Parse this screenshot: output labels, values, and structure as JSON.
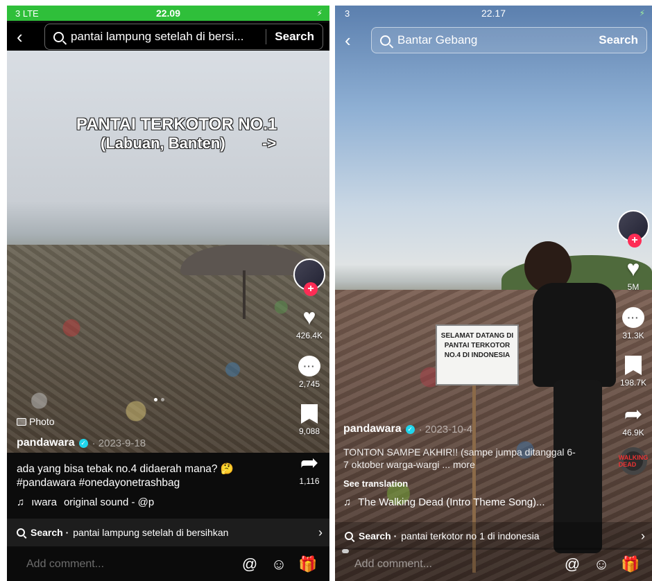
{
  "left": {
    "status": {
      "signal": "3 LTE",
      "time": "22.09",
      "battery": "⚡"
    },
    "search": {
      "query": "pantai lampung setelah di bersi...",
      "button": "Search"
    },
    "overlay": {
      "line1": "PANTAI TERKOTOR NO.1",
      "line2": "(Labuan, Banten)",
      "arrow": "->"
    },
    "photo_tag": "Photo",
    "rail": {
      "likes": "426.4K",
      "comments": "2,745",
      "saves": "9,088",
      "shares": "1,116"
    },
    "user": {
      "name": "pandawara",
      "date": "· 2023-9-18"
    },
    "caption": "ada yang bisa tebak no.4 didaerah mana? 🤔 #pandawara #onedayonetrashbag",
    "music": {
      "artist": "ıwara",
      "title": "original sound - @p"
    },
    "related": {
      "label": "Search ·",
      "query": "pantai lampung setelah di bersihkan"
    },
    "comment_placeholder": "Add comment..."
  },
  "right": {
    "status": {
      "signal": "3",
      "time": "22.17",
      "battery": "⚡"
    },
    "search": {
      "query": "Bantar Gebang",
      "button": "Search"
    },
    "sign": {
      "text": "SELAMAT DATANG DI PANTAI TERKOTOR NO.4 DI INDONESIA"
    },
    "rail": {
      "likes": "5M",
      "comments": "31.3K",
      "saves": "198.7K",
      "shares": "46.9K",
      "disc": "WALKING DEAD"
    },
    "user": {
      "name": "pandawara",
      "date": "· 2023-10-4"
    },
    "caption": "TONTON SAMPE AKHIR!! (sampe jumpa ditanggal 6-7 oktober warga-wargi ... more",
    "see_translation": "See translation",
    "music": {
      "title": "The Walking Dead (Intro Theme Song)..."
    },
    "related": {
      "label": "Search ·",
      "query": "pantai terkotor no 1 di indonesia"
    },
    "comment_placeholder": "Add comment..."
  },
  "colors": {
    "accent_green": "#2fbf3a",
    "tiktok_red": "#fe2c55",
    "verified_blue": "#20d5ec"
  },
  "icons": [
    "back-icon",
    "search-icon",
    "heart-icon",
    "comment-icon",
    "bookmark-icon",
    "share-icon",
    "music-note-icon",
    "at-icon",
    "emoji-icon",
    "gift-icon",
    "chevron-right-icon",
    "photo-icon"
  ]
}
